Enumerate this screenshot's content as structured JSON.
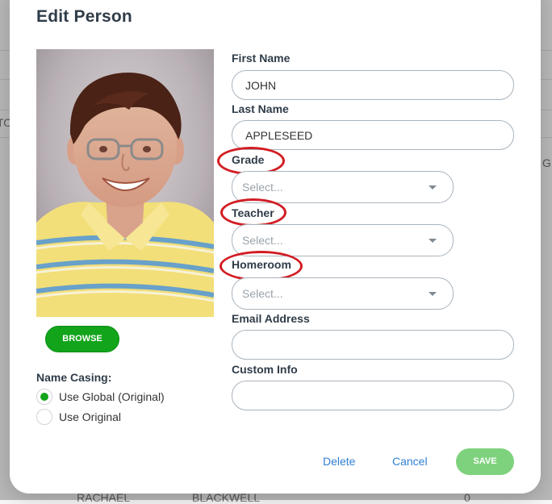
{
  "background": {
    "text_left": "TO",
    "text_right": "GR",
    "row_first": "RACHAEL",
    "row_last": "BLACKWELL",
    "row_value": "0"
  },
  "modal": {
    "title": "Edit Person",
    "browse_label": "BROWSE",
    "name_casing": {
      "label": "Name Casing:",
      "options": [
        {
          "label": "Use Global (Original)",
          "checked": true
        },
        {
          "label": "Use Original",
          "checked": false
        }
      ]
    },
    "fields": {
      "first_name": {
        "label": "First Name",
        "value": "JOHN"
      },
      "last_name": {
        "label": "Last Name",
        "value": "APPLESEED"
      },
      "grade": {
        "label": "Grade",
        "placeholder": "Select..."
      },
      "teacher": {
        "label": "Teacher",
        "placeholder": "Select..."
      },
      "homeroom": {
        "label": "Homeroom",
        "placeholder": "Select..."
      },
      "email": {
        "label": "Email Address",
        "value": ""
      },
      "custom": {
        "label": "Custom Info",
        "value": ""
      }
    },
    "actions": {
      "delete": "Delete",
      "cancel": "Cancel",
      "save": "SAVE"
    },
    "colors": {
      "accent_green": "#12a41b",
      "save_green_disabled": "#7fd27d",
      "link_blue": "#2f7fd2",
      "annotation_red": "#d21d23"
    }
  }
}
